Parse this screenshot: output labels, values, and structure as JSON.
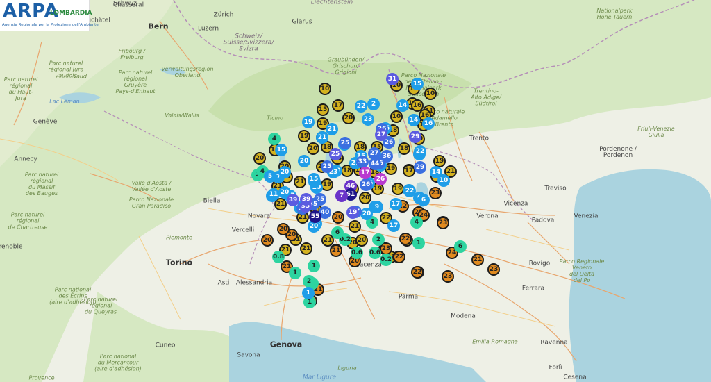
{
  "logo": {
    "mark": "ARPA",
    "region": "LOMBARDIA",
    "tagline": "Agenzia Regionale per la Protezione dell'Ambiente"
  },
  "colors": {
    "land": "#eef0e6",
    "forest": "#cfe3b6",
    "water": "#aad3df",
    "road": "#e8a66e",
    "border": "#b58fb8",
    "marker_palette": [
      "#2dd4a0",
      "#1f9ee8",
      "#3b6fe0",
      "#5b5be0",
      "#6a34c9",
      "#1d1488",
      "#b93ad0",
      "#d4b21f",
      "#e08a1f"
    ]
  },
  "labels": [
    {
      "text": "Schwyz",
      "type": "city"
    },
    {
      "text": "Liechtenstein",
      "type": "country"
    },
    {
      "text": "Zürich",
      "type": "city"
    },
    {
      "text": "Glarus",
      "type": "city"
    },
    {
      "text": "Luzern",
      "type": "city"
    },
    {
      "text": "Bern",
      "type": "big-city"
    },
    {
      "text": "Neuchâtel",
      "type": "city"
    },
    {
      "text": "Chasseral",
      "type": "city"
    },
    {
      "text": "Schweiz/\nSuisse/Svizzera/\nSvizra",
      "type": "country"
    },
    {
      "text": "Graubünden/\nGrischun/\nGrigioni",
      "type": "region"
    },
    {
      "text": "Nationalpark\nHohe Tauern",
      "type": "region"
    },
    {
      "text": "Fribourg /\nFreiburg",
      "type": "region"
    },
    {
      "text": "Parc naturel\nrégional\nGruyère\nPays-d'Enhaut",
      "type": "region"
    },
    {
      "text": "Parc naturel\nrégional Jura\nvaudois",
      "type": "region"
    },
    {
      "text": "Parc naturel\nrégional\ndu Haut-\nJura",
      "type": "region"
    },
    {
      "text": "Vaud",
      "type": "region"
    },
    {
      "text": "Verwaltungsregion\nOberland",
      "type": "region"
    },
    {
      "text": "Valais/Wallis",
      "type": "region"
    },
    {
      "text": "Lac Léman",
      "type": "lake"
    },
    {
      "text": "Genève",
      "type": "city"
    },
    {
      "text": "Annecy",
      "type": "city"
    },
    {
      "text": "Ticino",
      "type": "region"
    },
    {
      "text": "Parco Nazionale\ndello Stelvio -\nNationalpark\nStilfserjoch",
      "type": "region"
    },
    {
      "text": "Trentino-\nAlto Adige/\nSüdtirol",
      "type": "region"
    },
    {
      "text": "Parco naturale\nAdamello\nBrenta",
      "type": "region"
    },
    {
      "text": "Trento",
      "type": "city"
    },
    {
      "text": "Friuli-Venezia\nGiulia",
      "type": "region"
    },
    {
      "text": "Pordenone /\nPordenon",
      "type": "city"
    },
    {
      "text": "Treviso",
      "type": "city"
    },
    {
      "text": "Verona",
      "type": "city"
    },
    {
      "text": "Vicenza",
      "type": "city"
    },
    {
      "text": "Padova",
      "type": "city"
    },
    {
      "text": "Venezia",
      "type": "city"
    },
    {
      "text": "Rovigo",
      "type": "city"
    },
    {
      "text": "Parco Regionale\nVeneto\ndel Delta\ndel Po",
      "type": "region"
    },
    {
      "text": "Ferrara",
      "type": "city"
    },
    {
      "text": "Modena",
      "type": "city"
    },
    {
      "text": "Parma",
      "type": "city"
    },
    {
      "text": "Piacenza",
      "type": "city"
    },
    {
      "text": "Emilia-Romagna",
      "type": "region"
    },
    {
      "text": "Ravenna",
      "type": "city"
    },
    {
      "text": "Forlì",
      "type": "city"
    },
    {
      "text": "Cesena",
      "type": "city"
    },
    {
      "text": "Liguria",
      "type": "region"
    },
    {
      "text": "Genova",
      "type": "big-city"
    },
    {
      "text": "Savona",
      "type": "city"
    },
    {
      "text": "Cuneo",
      "type": "city"
    },
    {
      "text": "Asti",
      "type": "city"
    },
    {
      "text": "Alessandria",
      "type": "city"
    },
    {
      "text": "Torino",
      "type": "big-city"
    },
    {
      "text": "Piemonte",
      "type": "region"
    },
    {
      "text": "Novara",
      "type": "city"
    },
    {
      "text": "Vercelli",
      "type": "city"
    },
    {
      "text": "Biella",
      "type": "city"
    },
    {
      "text": "Valle d'Aosta /\nVallée d'Aoste",
      "type": "region"
    },
    {
      "text": "Parco Nazionale\nGran Paradiso",
      "type": "region"
    },
    {
      "text": "Parc naturel\nrégional\ndu Massif\ndes Bauges",
      "type": "region"
    },
    {
      "text": "Parc naturel\nrégional\nde Chartreuse",
      "type": "region"
    },
    {
      "text": "Grenoble",
      "type": "city"
    },
    {
      "text": "Parc national\ndes Écrins\n(aire d'adhésion)",
      "type": "region"
    },
    {
      "text": "Parc naturel\nrégional\ndu Queyras",
      "type": "region"
    },
    {
      "text": "Parc national\ndu Mercantour\n(aire d'adhésion)",
      "type": "region"
    },
    {
      "text": "Provence",
      "type": "region"
    },
    {
      "text": "Mar Ligure",
      "type": "sea"
    }
  ],
  "markers": [
    {
      "v": "10",
      "c": 7
    },
    {
      "v": "15",
      "c": 7
    },
    {
      "v": "17",
      "c": 7
    },
    {
      "v": "19",
      "c": 7
    },
    {
      "v": "20",
      "c": 7
    },
    {
      "v": "19",
      "c": 7
    },
    {
      "v": "20",
      "c": 7
    },
    {
      "v": "18",
      "c": 7
    },
    {
      "v": "15",
      "c": 7
    },
    {
      "v": "20",
      "c": 7
    },
    {
      "v": "18",
      "c": 7
    },
    {
      "v": "18",
      "c": 7
    },
    {
      "v": "15",
      "c": 7
    },
    {
      "v": "20",
      "c": 7
    },
    {
      "v": "18",
      "c": 7
    },
    {
      "v": "18",
      "c": 7
    },
    {
      "v": "19",
      "c": 7
    },
    {
      "v": "19",
      "c": 7
    },
    {
      "v": "18",
      "c": 7
    },
    {
      "v": "17",
      "c": 7
    },
    {
      "v": "19",
      "c": 7
    },
    {
      "v": "19",
      "c": 7
    },
    {
      "v": "19",
      "c": 7
    },
    {
      "v": "20",
      "c": 7
    },
    {
      "v": "21",
      "c": 7
    },
    {
      "v": "21",
      "c": 7
    },
    {
      "v": "20",
      "c": 7
    },
    {
      "v": "20",
      "c": 7
    },
    {
      "v": "21",
      "c": 7
    },
    {
      "v": "21",
      "c": 7
    },
    {
      "v": "21",
      "c": 7
    },
    {
      "v": "21",
      "c": 7
    },
    {
      "v": "21",
      "c": 7
    },
    {
      "v": "21",
      "c": 7
    },
    {
      "v": "20",
      "c": 7
    },
    {
      "v": "21",
      "c": 7
    },
    {
      "v": "21",
      "c": 7
    },
    {
      "v": "20",
      "c": 7
    },
    {
      "v": "21",
      "c": 7
    },
    {
      "v": "21",
      "c": 7
    },
    {
      "v": "22",
      "c": 7
    },
    {
      "v": "22",
      "c": 7
    },
    {
      "v": "23",
      "c": 7
    },
    {
      "v": "22",
      "c": 7
    },
    {
      "v": "10",
      "c": 7
    },
    {
      "v": "15",
      "c": 7
    },
    {
      "v": "10",
      "c": 7
    },
    {
      "v": "16",
      "c": 7
    },
    {
      "v": "11",
      "c": 7
    },
    {
      "v": "10",
      "c": 7
    },
    {
      "v": "14",
      "c": 7
    },
    {
      "v": "18",
      "c": 7
    },
    {
      "v": "18",
      "c": 7
    },
    {
      "v": "19",
      "c": 7
    },
    {
      "v": "17",
      "c": 7
    },
    {
      "v": "21",
      "c": 7
    },
    {
      "v": "19",
      "c": 7
    },
    {
      "v": "16",
      "c": 7
    },
    {
      "v": "18",
      "c": 7
    },
    {
      "v": "16",
      "c": 7
    },
    {
      "v": "22",
      "c": 8
    },
    {
      "v": "20",
      "c": 8
    },
    {
      "v": "21",
      "c": 8
    },
    {
      "v": "21",
      "c": 8
    },
    {
      "v": "20",
      "c": 8
    },
    {
      "v": "20",
      "c": 8
    },
    {
      "v": "22",
      "c": 8
    },
    {
      "v": "23",
      "c": 8
    },
    {
      "v": "22",
      "c": 8
    },
    {
      "v": "22",
      "c": 8
    },
    {
      "v": "24",
      "c": 8
    },
    {
      "v": "24",
      "c": 8
    },
    {
      "v": "23",
      "c": 8
    },
    {
      "v": "23",
      "c": 8
    },
    {
      "v": "23",
      "c": 8
    },
    {
      "v": "21",
      "c": 8
    },
    {
      "v": "22",
      "c": 8
    },
    {
      "v": "22",
      "c": 8
    },
    {
      "v": "21",
      "c": 8
    },
    {
      "v": "23",
      "c": 8
    },
    {
      "v": "20",
      "c": 8
    },
    {
      "v": "22",
      "c": 8
    },
    {
      "v": "20",
      "c": 8
    },
    {
      "v": "21",
      "c": 8
    },
    {
      "v": "23",
      "c": 8
    },
    {
      "v": "4",
      "c": 0
    },
    {
      "v": "2",
      "c": 0
    },
    {
      "v": "4",
      "c": 0
    },
    {
      "v": "1",
      "c": 0
    },
    {
      "v": "1",
      "c": 0
    },
    {
      "v": "1",
      "c": 0
    },
    {
      "v": "0.8",
      "c": 0
    },
    {
      "v": "2",
      "c": 0
    },
    {
      "v": "1",
      "c": 0
    },
    {
      "v": "0.6",
      "c": 0
    },
    {
      "v": "0.6",
      "c": 0
    },
    {
      "v": "0.2",
      "c": 0
    },
    {
      "v": "4",
      "c": 0
    },
    {
      "v": "4",
      "c": 0
    },
    {
      "v": "6",
      "c": 0
    },
    {
      "v": "6",
      "c": 0
    },
    {
      "v": "1",
      "c": 0
    },
    {
      "v": "0.2",
      "c": 0
    },
    {
      "v": "2",
      "c": 0
    },
    {
      "v": "15",
      "c": 1
    },
    {
      "v": "14",
      "c": 1
    },
    {
      "v": "19",
      "c": 1
    },
    {
      "v": "22",
      "c": 1
    },
    {
      "v": "21",
      "c": 1
    },
    {
      "v": "17",
      "c": 1
    },
    {
      "v": "15",
      "c": 1
    },
    {
      "v": "18",
      "c": 1
    },
    {
      "v": "22",
      "c": 1
    },
    {
      "v": "17",
      "c": 1
    },
    {
      "v": "22",
      "c": 1
    },
    {
      "v": "23",
      "c": 1
    },
    {
      "v": "26",
      "c": 1
    },
    {
      "v": "20",
      "c": 1
    },
    {
      "v": "21",
      "c": 1
    },
    {
      "v": "23",
      "c": 1
    },
    {
      "v": "18",
      "c": 1
    },
    {
      "v": "17",
      "c": 1
    },
    {
      "v": "9",
      "c": 1
    },
    {
      "v": "17",
      "c": 1
    },
    {
      "v": "6",
      "c": 1
    },
    {
      "v": "6",
      "c": 1
    },
    {
      "v": "23",
      "c": 1
    },
    {
      "v": "22",
      "c": 1
    },
    {
      "v": "15",
      "c": 1
    },
    {
      "v": "15",
      "c": 1
    },
    {
      "v": "14",
      "c": 1
    },
    {
      "v": "5",
      "c": 1
    },
    {
      "v": "7",
      "c": 1
    },
    {
      "v": "11",
      "c": 1
    },
    {
      "v": "24",
      "c": 1
    },
    {
      "v": "20",
      "c": 1
    },
    {
      "v": "22",
      "c": 1
    },
    {
      "v": "16",
      "c": 1
    },
    {
      "v": "21",
      "c": 1
    },
    {
      "v": "20",
      "c": 1
    },
    {
      "v": "14",
      "c": 1
    },
    {
      "v": "21",
      "c": 1
    },
    {
      "v": "19",
      "c": 1
    },
    {
      "v": "20",
      "c": 1
    },
    {
      "v": "20",
      "c": 1
    },
    {
      "v": "9",
      "c": 1
    },
    {
      "v": "10",
      "c": 1
    },
    {
      "v": "20",
      "c": 1
    },
    {
      "v": "23",
      "c": 1
    },
    {
      "v": "26",
      "c": 2
    },
    {
      "v": "35",
      "c": 2
    },
    {
      "v": "25",
      "c": 2
    },
    {
      "v": "26",
      "c": 2
    },
    {
      "v": "33",
      "c": 2
    },
    {
      "v": "44",
      "c": 2
    },
    {
      "v": "36",
      "c": 2
    },
    {
      "v": "27",
      "c": 2
    },
    {
      "v": "26",
      "c": 2
    },
    {
      "v": "29",
      "c": 2
    },
    {
      "v": "26",
      "c": 2
    },
    {
      "v": "25",
      "c": 2
    },
    {
      "v": "25",
      "c": 2
    },
    {
      "v": "40",
      "c": 2
    },
    {
      "v": "37",
      "c": 2
    },
    {
      "v": "35",
      "c": 2
    },
    {
      "v": "31",
      "c": 3
    },
    {
      "v": "35",
      "c": 3
    },
    {
      "v": "39",
      "c": 3
    },
    {
      "v": "39",
      "c": 3
    },
    {
      "v": "29",
      "c": 3
    },
    {
      "v": "25",
      "c": 3
    },
    {
      "v": "27",
      "c": 3
    },
    {
      "v": "19",
      "c": 3
    },
    {
      "v": "46",
      "c": 4
    },
    {
      "v": "55",
      "c": 5
    },
    {
      "v": "61",
      "c": 5
    },
    {
      "v": "7",
      "c": 4
    },
    {
      "v": "17",
      "c": 6
    },
    {
      "v": "26",
      "c": 6
    },
    {
      "v": "2",
      "c": 1
    },
    {
      "v": "15",
      "c": 1
    },
    {
      "v": "1",
      "c": 1
    }
  ]
}
